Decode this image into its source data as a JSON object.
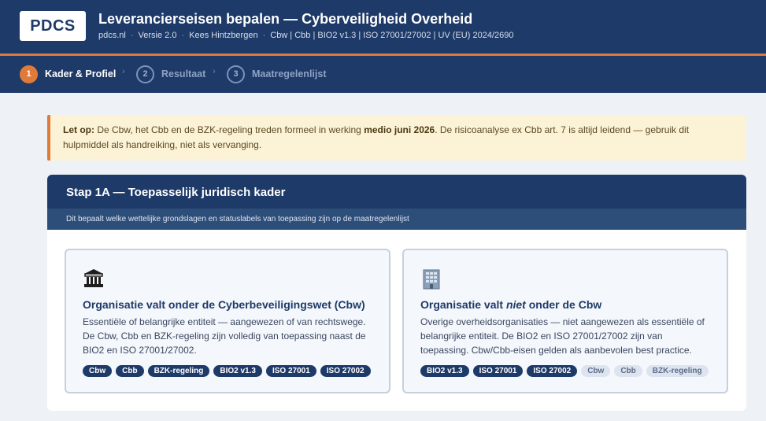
{
  "header": {
    "logo": "PDCS",
    "title": "Leverancierseisen bepalen — Cyberveiligheid Overheid",
    "meta": [
      "pdcs.nl",
      "Versie 2.0",
      "Kees Hintzbergen",
      "Cbw | Cbb | BIO2 v1.3 | ISO 27001/27002 | UV (EU) 2024/2690"
    ]
  },
  "steps": [
    {
      "num": "1",
      "label": "Kader & Profiel"
    },
    {
      "num": "2",
      "label": "Resultaat"
    },
    {
      "num": "3",
      "label": "Maatregelenlijst"
    }
  ],
  "notice": {
    "prefix": "Let op:",
    "text1": " De Cbw, het Cbb en de BZK-regeling treden formeel in werking ",
    "bold": "medio juni 2026",
    "text2": ". De risicoanalyse ex Cbb art. 7 is altijd leidend — gebruik dit hulpmiddel als handreiking, niet als vervanging."
  },
  "section": {
    "title": "Stap 1A — Toepasselijk juridisch kader",
    "subtitle": "Dit bepaalt welke wettelijke grondslagen en statuslabels van toepassing zijn op de maatregelenlijst"
  },
  "options": [
    {
      "icon": "government-building-icon",
      "title": "Organisatie valt onder de Cyberbeveiligingswet (Cbw)",
      "description": "Essentiële of belangrijke entiteit — aangewezen of van rechtswege. De Cbw, Cbb en BZK-regeling zijn volledig van toepassing naast de BIO2 en ISO 27001/27002.",
      "tags": [
        {
          "label": "Cbw",
          "style": "solid"
        },
        {
          "label": "Cbb",
          "style": "solid"
        },
        {
          "label": "BZK-regeling",
          "style": "solid"
        },
        {
          "label": "BIO2 v1.3",
          "style": "solid"
        },
        {
          "label": "ISO 27001",
          "style": "solid"
        },
        {
          "label": "ISO 27002",
          "style": "solid"
        }
      ]
    },
    {
      "icon": "office-building-icon",
      "title_pre": "Organisatie valt ",
      "title_em": "niet",
      "title_post": " onder de Cbw",
      "description": "Overige overheidsorganisaties — niet aangewezen als essentiële of belangrijke entiteit. De BIO2 en ISO 27001/27002 zijn van toepassing. Cbw/Cbb-eisen gelden als aanbevolen best practice.",
      "tags": [
        {
          "label": "BIO2 v1.3",
          "style": "solid"
        },
        {
          "label": "ISO 27001",
          "style": "solid"
        },
        {
          "label": "ISO 27002",
          "style": "solid"
        },
        {
          "label": "Cbw",
          "style": "soft"
        },
        {
          "label": "Cbb",
          "style": "soft"
        },
        {
          "label": "BZK-regeling",
          "style": "soft"
        }
      ]
    }
  ]
}
